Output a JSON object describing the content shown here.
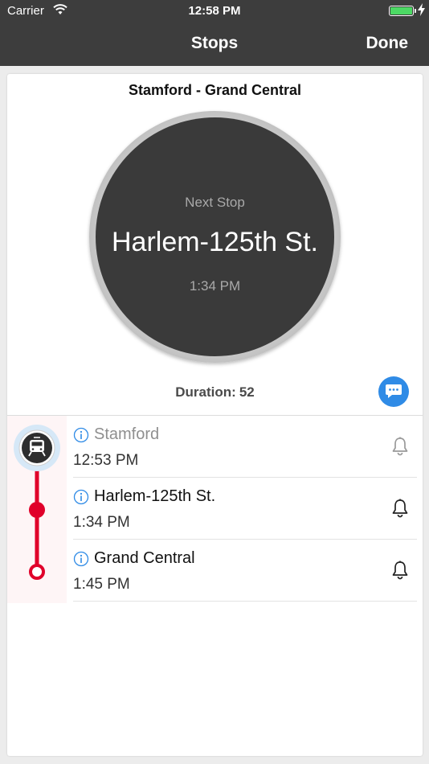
{
  "status_bar": {
    "carrier": "Carrier",
    "time": "12:58 PM",
    "battery_level": 1.0
  },
  "nav": {
    "title": "Stops",
    "done_label": "Done"
  },
  "route": {
    "title": "Stamford - Grand Central"
  },
  "next_stop": {
    "label": "Next Stop",
    "station": "Harlem-125th St.",
    "time": "1:34 PM"
  },
  "duration": {
    "label": "Duration:",
    "value": "52"
  },
  "stops": [
    {
      "name": "Stamford",
      "time": "12:53 PM",
      "passed": true,
      "icon": "info-icon",
      "alert_icon": "bell-icon"
    },
    {
      "name": "Harlem-125th St.",
      "time": "1:34 PM",
      "passed": false,
      "icon": "info-icon",
      "alert_icon": "bell-icon"
    },
    {
      "name": "Grand Central",
      "time": "1:45 PM",
      "passed": false,
      "icon": "info-icon",
      "alert_icon": "bell-icon"
    }
  ],
  "colors": {
    "nav_bg": "#3d3d3d",
    "line": "#e0002a",
    "accent_blue": "#2f8be6",
    "disc": "#3a3a3a"
  },
  "icons": {
    "current_position": "train-icon",
    "chat": "chat-bubble-icon"
  }
}
